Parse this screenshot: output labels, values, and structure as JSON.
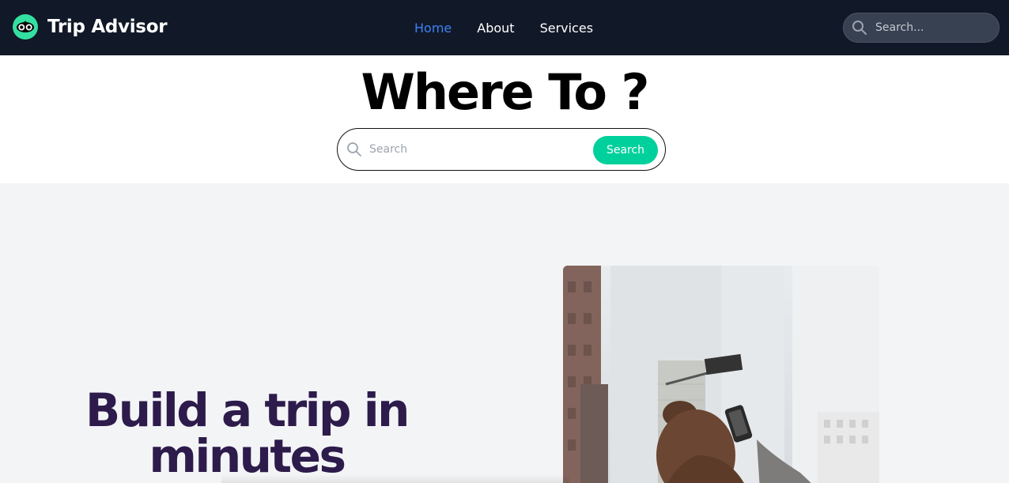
{
  "brand": {
    "name": "Trip Advisor",
    "logo_icon": "owl-eyes-icon",
    "logo_color": "#34e0a1"
  },
  "nav": {
    "links": [
      {
        "label": "Home",
        "active": true
      },
      {
        "label": "About",
        "active": false
      },
      {
        "label": "Services",
        "active": false
      }
    ],
    "search": {
      "placeholder": "Search...",
      "icon": "search-icon"
    }
  },
  "hero": {
    "title": "Where To ?",
    "search": {
      "placeholder": "Search",
      "button_label": "Search",
      "button_color": "#00d09c"
    }
  },
  "feature": {
    "heading": "Build a trip in minutes",
    "image": {
      "icon": "photo-woman-with-phone-city"
    }
  },
  "colors": {
    "nav_bg": "#111827",
    "active_link": "#3b82f6",
    "heading_purple": "#2d1b4b",
    "section_bg": "#f3f4f6"
  }
}
